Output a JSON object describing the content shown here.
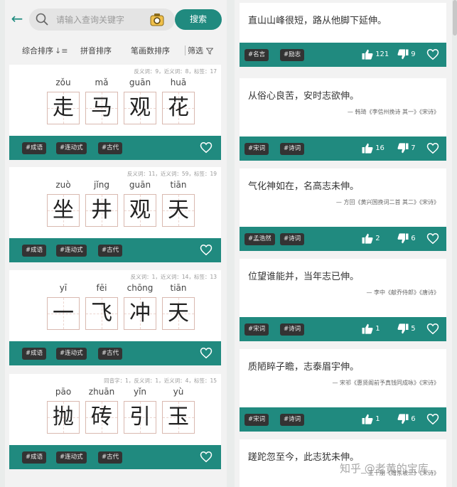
{
  "search": {
    "placeholder": "请输入查询关键字",
    "button": "搜索"
  },
  "sort": {
    "comprehensive": "综合排序",
    "pinyin": "拼音排序",
    "strokes": "笔画数排序",
    "filter": "筛选"
  },
  "idioms": [
    {
      "stats": "反义词：9，近义词：8，标签：17",
      "chars": [
        {
          "py": "zǒu",
          "hz": "走"
        },
        {
          "py": "mǎ",
          "hz": "马"
        },
        {
          "py": "guān",
          "hz": "观"
        },
        {
          "py": "huā",
          "hz": "花"
        }
      ],
      "tags": [
        "#成语",
        "#连动式",
        "#古代"
      ]
    },
    {
      "stats": "反义词：11，近义词：59，标签：19",
      "chars": [
        {
          "py": "zuò",
          "hz": "坐"
        },
        {
          "py": "jǐng",
          "hz": "井"
        },
        {
          "py": "guān",
          "hz": "观"
        },
        {
          "py": "tiān",
          "hz": "天"
        }
      ],
      "tags": [
        "#成语",
        "#连动式",
        "#古代"
      ]
    },
    {
      "stats": "反义词：1，近义词：14，标签：13",
      "chars": [
        {
          "py": "yī",
          "hz": "一"
        },
        {
          "py": "fēi",
          "hz": "飞"
        },
        {
          "py": "chōng",
          "hz": "冲"
        },
        {
          "py": "tiān",
          "hz": "天"
        }
      ],
      "tags": [
        "#成语",
        "#连动式",
        "#古代"
      ]
    },
    {
      "stats": "同音字：1，反义词：1，近义词：4，标签：15",
      "chars": [
        {
          "py": "pāo",
          "hz": "抛"
        },
        {
          "py": "zhuān",
          "hz": "砖"
        },
        {
          "py": "yǐn",
          "hz": "引"
        },
        {
          "py": "yù",
          "hz": "玉"
        }
      ],
      "tags": [
        "#成语",
        "#连动式",
        "#古代"
      ]
    }
  ],
  "quotes": [
    {
      "text": "直山山峰很短，路从他脚下延伸。",
      "source": "",
      "tags": [
        "#名言",
        "#励志"
      ],
      "likes": "121",
      "dislikes": "9"
    },
    {
      "text": "从俗心良苦，安时志欲伸。",
      "source": "— 韩琦《李信州挽诗 其一》《宋诗》",
      "tags": [
        "#宋词",
        "#诗词"
      ],
      "likes": "16",
      "dislikes": "7"
    },
    {
      "text": "气化神如在，名高志未伸。",
      "source": "— 方回《黄兴国挽词二首 其二》《宋诗》",
      "tags": [
        "#孟浩然",
        "#诗词"
      ],
      "likes": "2",
      "dislikes": "6"
    },
    {
      "text": "位望谁能并，当年志已伸。",
      "source": "— 李中《献乔侍郎》《唐诗》",
      "tags": [
        "#宋词",
        "#诗词"
      ],
      "likes": "1",
      "dislikes": "5"
    },
    {
      "text": "质陋睟子瞻，志泰眉宇伸。",
      "source": "— 宋祁《惠贤阁前予真钱同成咏》《宋诗》",
      "tags": [
        "#宋词",
        "#诗词"
      ],
      "likes": "1",
      "dislikes": "6"
    },
    {
      "text": "蹉跎忽至今，此志犹未伸。",
      "source": "— 王十朋《赠东坡三》《宋诗》",
      "tags": [],
      "likes": "",
      "dislikes": ""
    }
  ],
  "watermark": "知乎 @老黄的宝库"
}
